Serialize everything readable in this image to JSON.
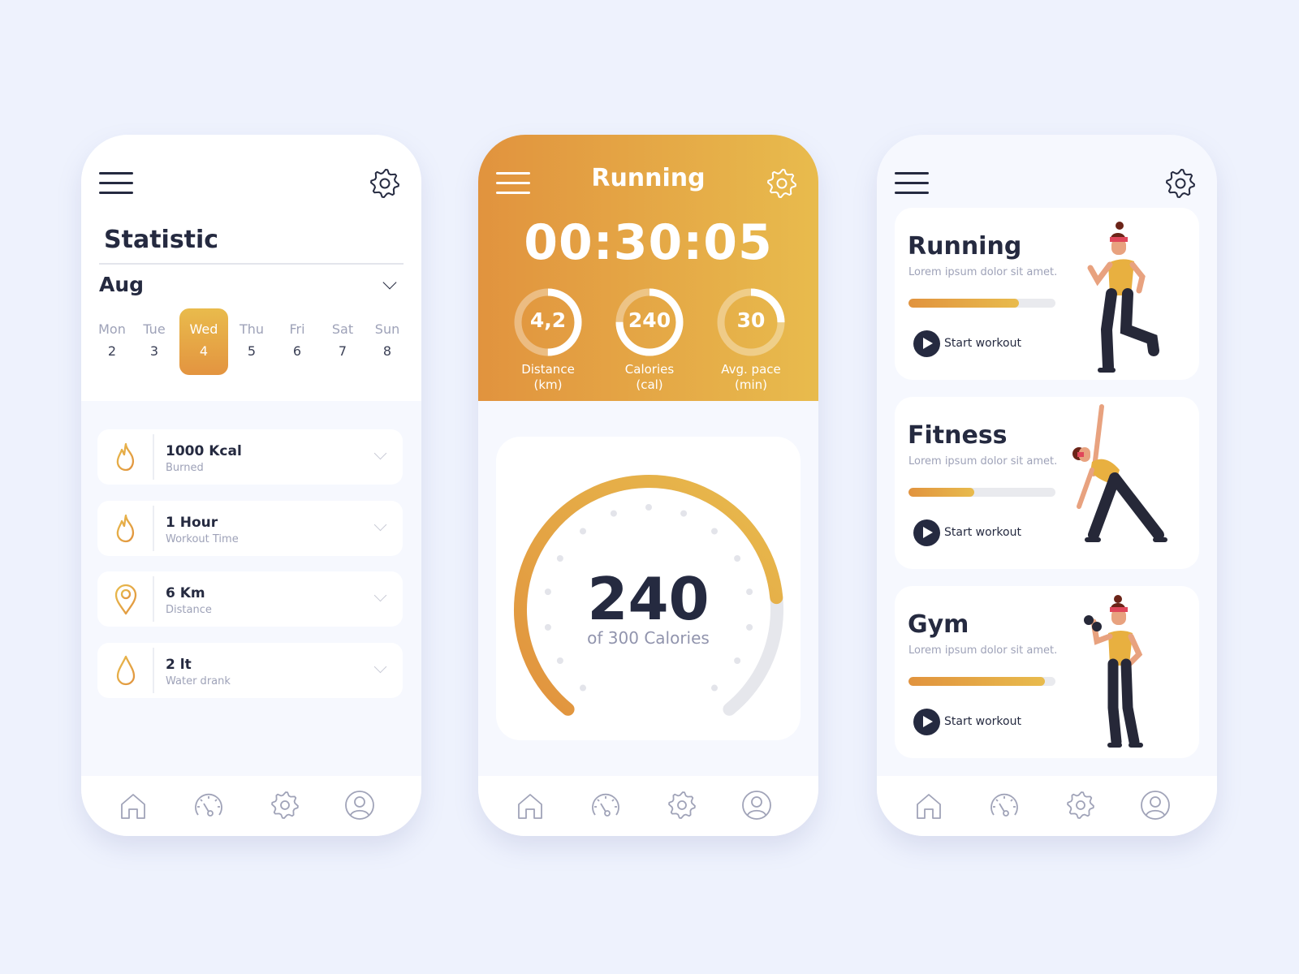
{
  "colors": {
    "accent_start": "#e1933e",
    "accent_end": "#e8bb4d",
    "dark": "#252a40",
    "muted": "#9ea2b8",
    "background": "#eef2fd"
  },
  "nav_icons": [
    "home-icon",
    "speedometer-icon",
    "gear-icon",
    "user-icon"
  ],
  "statistic": {
    "title": "Statistic",
    "month": "Aug",
    "days": [
      {
        "name": "Mon",
        "num": "2"
      },
      {
        "name": "Tue",
        "num": "3"
      },
      {
        "name": "Wed",
        "num": "4"
      },
      {
        "name": "Thu",
        "num": "5"
      },
      {
        "name": "Fri",
        "num": "6"
      },
      {
        "name": "Sat",
        "num": "7"
      },
      {
        "name": "Sun",
        "num": "8"
      }
    ],
    "selected_day": "Wed",
    "items": [
      {
        "value": "1000 Kcal",
        "label": "Burned",
        "icon": "flame-icon"
      },
      {
        "value": "1 Hour",
        "label": "Workout Time",
        "icon": "flame-icon"
      },
      {
        "value": "6 Km",
        "label": "Distance",
        "icon": "location-pin-icon"
      },
      {
        "value": "2 lt",
        "label": "Water drank",
        "icon": "water-drop-icon"
      }
    ]
  },
  "running": {
    "title": "Running",
    "timer": "00:30:05",
    "rings": [
      {
        "value": "4,2",
        "label": "Distance",
        "unit": "(km)",
        "progress": 0.5
      },
      {
        "value": "240",
        "label": "Calories",
        "unit": "(cal)",
        "progress": 0.75
      },
      {
        "value": "30",
        "label": "Avg. pace",
        "unit": "(min)",
        "progress": 0.25
      }
    ],
    "gauge": {
      "value": "240",
      "caption": "of 300 Calories",
      "current": 240,
      "max": 300
    }
  },
  "workouts": {
    "cards": [
      {
        "title": "Running",
        "desc": "Lorem ipsum dolor sit amet.",
        "progress": 0.75,
        "button": "Start workout"
      },
      {
        "title": "Fitness",
        "desc": "Lorem ipsum dolor sit amet.",
        "progress": 0.45,
        "button": "Start workout"
      },
      {
        "title": "Gym",
        "desc": "Lorem ipsum dolor sit amet.",
        "progress": 0.93,
        "button": "Start workout"
      }
    ]
  }
}
